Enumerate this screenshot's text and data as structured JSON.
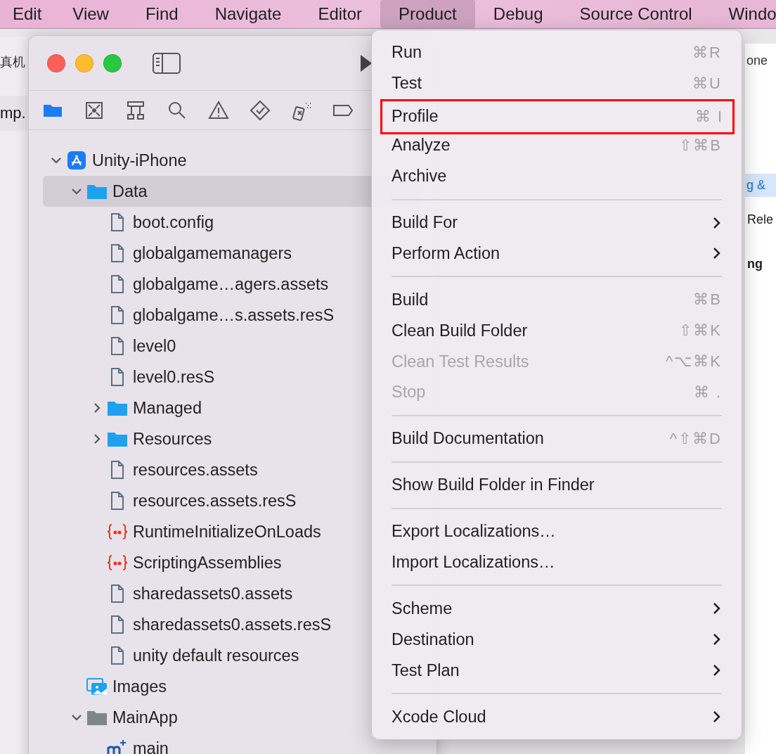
{
  "menubar": [
    {
      "label": "Edit",
      "selected": false
    },
    {
      "label": "View",
      "selected": false
    },
    {
      "label": "Find",
      "selected": false
    },
    {
      "label": "Navigate",
      "selected": false
    },
    {
      "label": "Editor",
      "selected": false
    },
    {
      "label": "Product",
      "selected": true
    },
    {
      "label": "Debug",
      "selected": false
    },
    {
      "label": "Source Control",
      "selected": false
    },
    {
      "label": "Windo",
      "selected": false
    }
  ],
  "left_window": {
    "title": "真机",
    "tab": "mp."
  },
  "right_window": {
    "breadcrumb": "one",
    "tab": "g &",
    "row": "Rele",
    "heading": "ng"
  },
  "navigator_tabs": [
    {
      "kind": "folder",
      "selected": true
    },
    {
      "kind": "xbox",
      "selected": false
    },
    {
      "kind": "hierarchy",
      "selected": false
    },
    {
      "kind": "search",
      "selected": false
    },
    {
      "kind": "warning",
      "selected": false
    },
    {
      "kind": "test",
      "selected": false
    },
    {
      "kind": "spray",
      "selected": false
    },
    {
      "kind": "tag",
      "selected": false
    }
  ],
  "tree": [
    {
      "label": "Unity-iPhone",
      "kind": "project",
      "expanded": true,
      "selected": false,
      "children": [
        {
          "label": "Data",
          "kind": "folder",
          "expanded": true,
          "selected": true,
          "children": [
            {
              "label": "boot.config",
              "kind": "file",
              "selected": false
            },
            {
              "label": "globalgamemanagers",
              "kind": "file",
              "selected": false
            },
            {
              "label": "globalgame…agers.assets",
              "kind": "file",
              "selected": false
            },
            {
              "label": "globalgame…s.assets.resS",
              "kind": "file",
              "selected": false
            },
            {
              "label": "level0",
              "kind": "file",
              "selected": false
            },
            {
              "label": "level0.resS",
              "kind": "file",
              "selected": false
            },
            {
              "label": "Managed",
              "kind": "folder",
              "expanded": false,
              "selected": false
            },
            {
              "label": "Resources",
              "kind": "folder",
              "expanded": false,
              "selected": false
            },
            {
              "label": "resources.assets",
              "kind": "file",
              "selected": false
            },
            {
              "label": "resources.assets.resS",
              "kind": "file",
              "selected": false
            },
            {
              "label": "RuntimeInitializeOnLoads",
              "kind": "strings",
              "selected": false
            },
            {
              "label": "ScriptingAssemblies",
              "kind": "strings",
              "selected": false
            },
            {
              "label": "sharedassets0.assets",
              "kind": "file",
              "selected": false
            },
            {
              "label": "sharedassets0.assets.resS",
              "kind": "file",
              "selected": false
            },
            {
              "label": "unity default resources",
              "kind": "file",
              "selected": false
            }
          ]
        },
        {
          "label": "Images",
          "kind": "assets",
          "selected": false
        },
        {
          "label": "MainApp",
          "kind": "group",
          "expanded": true,
          "selected": false,
          "children": [
            {
              "label": "main",
              "kind": "mfile",
              "selected": false
            }
          ]
        }
      ]
    }
  ],
  "menu": {
    "items": [
      {
        "kind": "item",
        "label": "Run",
        "shortcut": "⌘R",
        "disabled": false,
        "submenu": false,
        "annotated": false
      },
      {
        "kind": "item",
        "label": "Test",
        "shortcut": "⌘U",
        "disabled": false,
        "submenu": false,
        "annotated": false
      },
      {
        "kind": "item",
        "label": "Profile",
        "shortcut": "⌘ I",
        "disabled": false,
        "submenu": false,
        "annotated": true
      },
      {
        "kind": "item",
        "label": "Analyze",
        "shortcut": "⇧⌘B",
        "disabled": false,
        "submenu": false,
        "annotated": false
      },
      {
        "kind": "item",
        "label": "Archive",
        "disabled": false,
        "submenu": false,
        "annotated": false
      },
      {
        "kind": "separator"
      },
      {
        "kind": "item",
        "label": "Build For",
        "disabled": false,
        "submenu": true,
        "annotated": false
      },
      {
        "kind": "item",
        "label": "Perform Action",
        "disabled": false,
        "submenu": true,
        "annotated": false
      },
      {
        "kind": "separator"
      },
      {
        "kind": "item",
        "label": "Build",
        "shortcut": "⌘B",
        "disabled": false,
        "submenu": false,
        "annotated": false
      },
      {
        "kind": "item",
        "label": "Clean Build Folder",
        "shortcut": "⇧⌘K",
        "disabled": false,
        "submenu": false,
        "annotated": false
      },
      {
        "kind": "item",
        "label": "Clean Test Results",
        "shortcut": "^⌥⌘K",
        "disabled": true,
        "submenu": false,
        "annotated": false
      },
      {
        "kind": "item",
        "label": "Stop",
        "shortcut": "⌘ .",
        "disabled": true,
        "submenu": false,
        "annotated": false
      },
      {
        "kind": "separator"
      },
      {
        "kind": "item",
        "label": "Build Documentation",
        "shortcut": "^⇧⌘D",
        "disabled": false,
        "submenu": false,
        "annotated": false
      },
      {
        "kind": "separator"
      },
      {
        "kind": "item",
        "label": "Show Build Folder in Finder",
        "disabled": false,
        "submenu": false,
        "annotated": false
      },
      {
        "kind": "separator"
      },
      {
        "kind": "item",
        "label": "Export Localizations…",
        "disabled": false,
        "submenu": false,
        "annotated": false
      },
      {
        "kind": "item",
        "label": "Import Localizations…",
        "disabled": false,
        "submenu": false,
        "annotated": false
      },
      {
        "kind": "separator"
      },
      {
        "kind": "item",
        "label": "Scheme",
        "disabled": false,
        "submenu": true,
        "annotated": false
      },
      {
        "kind": "item",
        "label": "Destination",
        "disabled": false,
        "submenu": true,
        "annotated": false
      },
      {
        "kind": "item",
        "label": "Test Plan",
        "disabled": false,
        "submenu": true,
        "annotated": false
      },
      {
        "kind": "separator"
      },
      {
        "kind": "item",
        "label": "Xcode Cloud",
        "disabled": false,
        "submenu": true,
        "annotated": false
      }
    ]
  }
}
